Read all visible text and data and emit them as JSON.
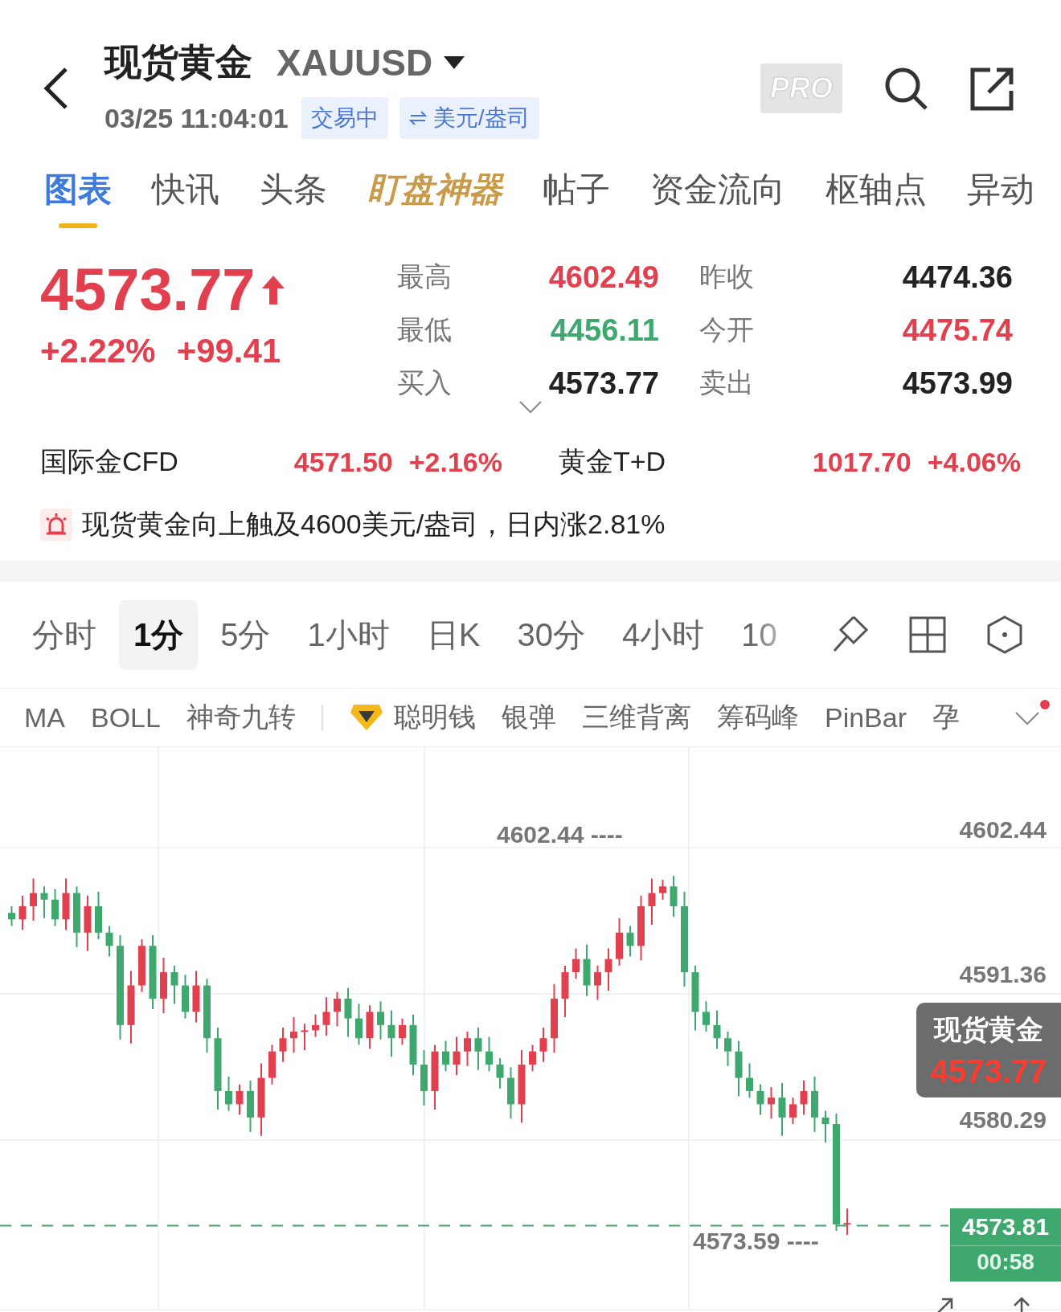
{
  "header": {
    "title": "现货黄金",
    "symbol": "XAUUSD",
    "datetime": "03/25 11:04:01",
    "status_badge": "交易中",
    "unit_badge": "美元/盎司",
    "pro_badge": "PRO"
  },
  "tabs": [
    {
      "label": "图表",
      "selected": true,
      "kind": "plain"
    },
    {
      "label": "快讯",
      "selected": false,
      "kind": "plain"
    },
    {
      "label": "头条",
      "selected": false,
      "kind": "plain"
    },
    {
      "label": "盯盘神器",
      "selected": false,
      "kind": "special"
    },
    {
      "label": "帖子",
      "selected": false,
      "kind": "plain"
    },
    {
      "label": "资金流向",
      "selected": false,
      "kind": "plain"
    },
    {
      "label": "枢轴点",
      "selected": false,
      "kind": "plain"
    },
    {
      "label": "异动",
      "selected": false,
      "kind": "plain"
    }
  ],
  "quote": {
    "price": "4573.77",
    "rising": true,
    "change_pct": "+2.22%",
    "change": "+99.41",
    "stats": [
      {
        "label": "最高",
        "value": "4602.49",
        "color": "#e2404e"
      },
      {
        "label": "昨收",
        "value": "4474.36",
        "color": "#222222"
      },
      {
        "label": "最低",
        "value": "4456.11",
        "color": "#3fa86e"
      },
      {
        "label": "今开",
        "value": "4475.74",
        "color": "#e2404e"
      },
      {
        "label": "买入",
        "value": "4573.77",
        "color": "#222222"
      },
      {
        "label": "卖出",
        "value": "4573.99",
        "color": "#222222"
      }
    ]
  },
  "related": [
    {
      "name": "国际金CFD",
      "price": "4571.50",
      "change": "+2.16%",
      "color": "#e2404e"
    },
    {
      "name": "黄金T+D",
      "price": "1017.70",
      "change": "+4.06%",
      "color": "#e2404e"
    }
  ],
  "alert": {
    "text": "现货黄金向上触及4600美元/盎司，日内涨2.81%"
  },
  "periods": [
    {
      "label": "分时",
      "selected": false
    },
    {
      "label": "1分",
      "selected": true
    },
    {
      "label": "5分",
      "selected": false
    },
    {
      "label": "1小时",
      "selected": false
    },
    {
      "label": "日K",
      "selected": false
    },
    {
      "label": "30分",
      "selected": false
    },
    {
      "label": "4小时",
      "selected": false
    },
    {
      "label": "10",
      "selected": false
    }
  ],
  "indicators": [
    {
      "label": "MA",
      "kind": "plain"
    },
    {
      "label": "BOLL",
      "kind": "plain"
    },
    {
      "label": "神奇九转",
      "kind": "plain"
    },
    {
      "label": "聪明钱",
      "kind": "premium"
    },
    {
      "label": "银弹",
      "kind": "plain"
    },
    {
      "label": "三维背离",
      "kind": "plain"
    },
    {
      "label": "筹码峰",
      "kind": "plain"
    },
    {
      "label": "PinBar",
      "kind": "plain"
    },
    {
      "label": "孕",
      "kind": "plain"
    }
  ],
  "indicator_menu": {
    "has_notification": true
  },
  "chart": {
    "y_labels": [
      "4602.44",
      "4591.36",
      "4580.29"
    ],
    "high_marker": "4602.44 ----",
    "low_marker": "4573.59 ----",
    "name_tag": {
      "name": "现货黄金",
      "price": "4573.77"
    },
    "last_tag": {
      "price": "4573.81",
      "countdown": "00:58"
    }
  }
}
